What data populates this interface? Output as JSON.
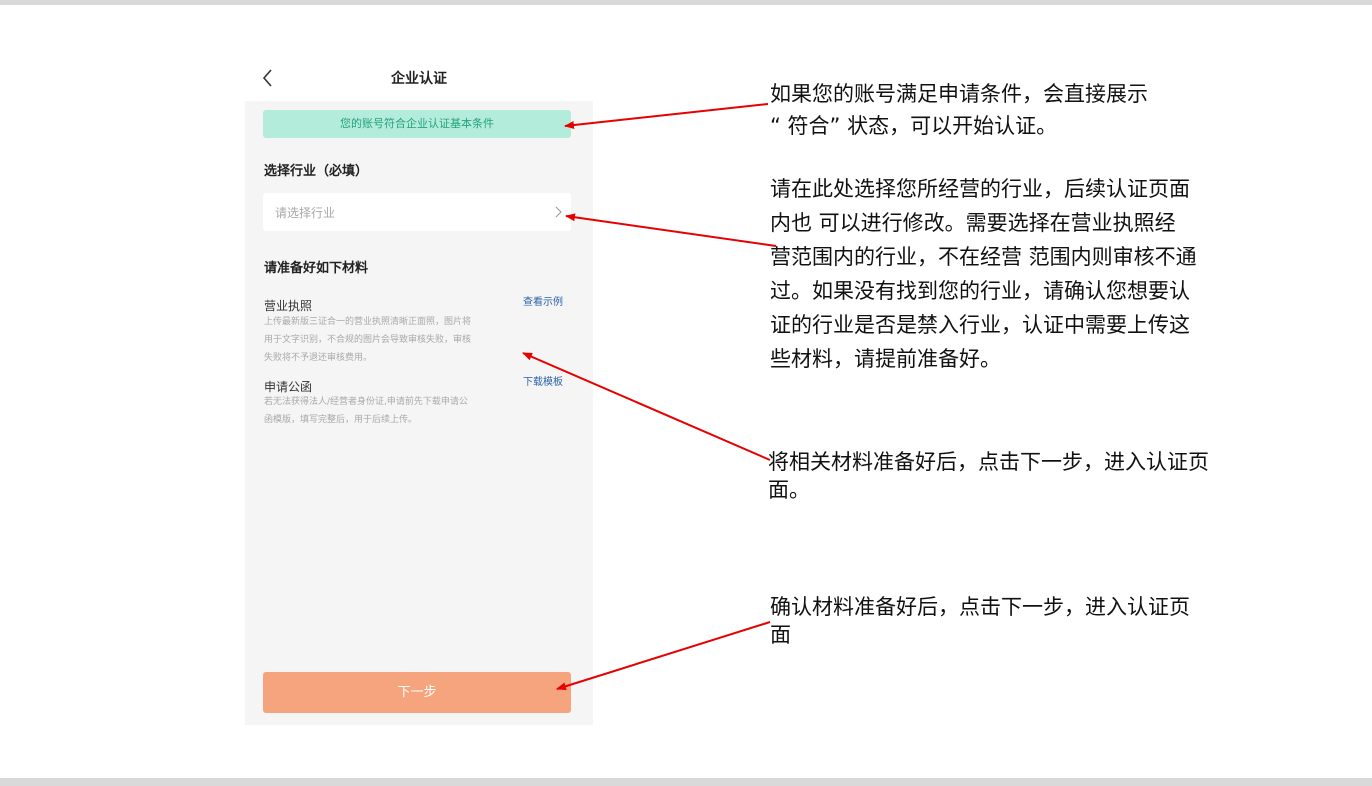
{
  "colors": {
    "notice_bg": "#b4ecdc",
    "notice_text": "#23a27a",
    "link": "#2c63a8",
    "primary_button": "#f6a47d",
    "arrow": "#e60000"
  },
  "icons": {
    "back": "chevron-left-icon",
    "select_arrow": "chevron-right-icon"
  },
  "app": {
    "title": "企业认证",
    "notice": "您的账号符合企业认证基本条件",
    "industry": {
      "section_title": "选择行业（必填）",
      "placeholder": "请选择行业"
    },
    "materials": {
      "section_title": "请准备好如下材料",
      "items": [
        {
          "title": "营业执照",
          "desc_lines": [
            "上传最新版三证合一的营业执照清晰正面照，图片将",
            "用于文字识别，不合规的图片会导致审核失败，审核",
            "失败将不予退还审核费用。"
          ],
          "link": "查看示例"
        },
        {
          "title": "申请公函",
          "desc_lines": [
            "若无法获得法人/经营者身份证,申请前先下载申请公",
            "函模版，填写完整后，用于后续上传。"
          ],
          "link": "下载模板"
        }
      ]
    },
    "next_button": "下一步"
  },
  "annotations": {
    "a1": [
      "如果您的账号满足申请条件，会直接展示",
      "“ 符合” 状态，可以开始认证。"
    ],
    "a2": [
      "请在此处选择您所经营的行业，后续认证页面",
      "内也 可以进行修改。需要选择在营业执照经",
      "营范围内的行业，不在经营 范围内则审核不通",
      "过。如果没有找到您的行业，请确认您想要认",
      "证的行业是否是禁入行业，认证中需要上传这",
      "些材料，请提前准备好。"
    ],
    "a3": [
      "将相关材料准备好后，点击下一步，进入认证页",
      "面。"
    ],
    "a4": [
      "确认材料准备好后，点击下一步，进入认证页",
      "面"
    ]
  }
}
